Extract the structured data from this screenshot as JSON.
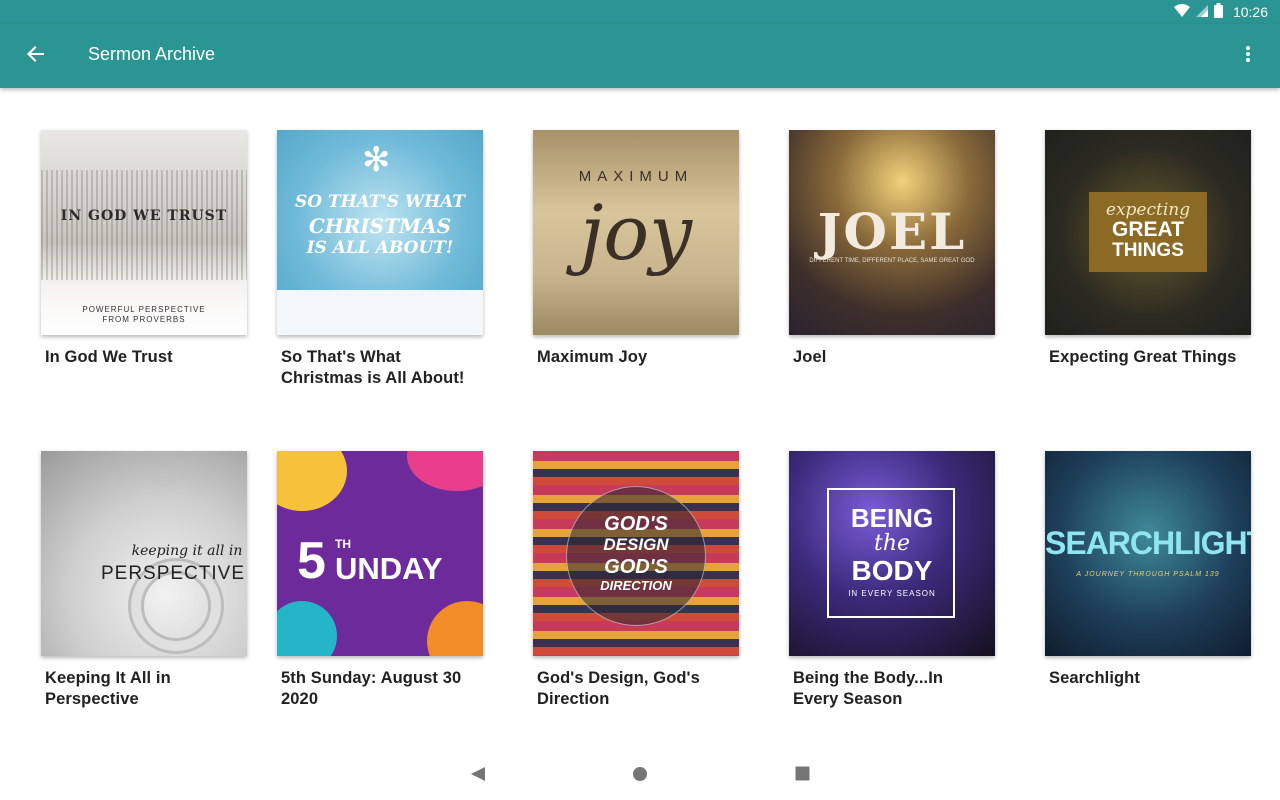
{
  "status": {
    "time": "10:26"
  },
  "app_bar": {
    "title": "Sermon Archive"
  },
  "colors": {
    "accent": "#2a9592"
  },
  "sermons": [
    {
      "title": "In God We Trust",
      "art": {
        "line1": "IN GOD WE TRUST",
        "line2": "POWERFUL PERSPECTIVE",
        "line3": "FROM PROVERBS"
      }
    },
    {
      "title": "So That's What Christmas is All About!",
      "art": {
        "line1": "SO THAT'S WHAT",
        "line2": "CHRISTMAS",
        "line3": "IS ALL ABOUT!"
      }
    },
    {
      "title": "Maximum Joy",
      "art": {
        "line1": "MAXIMUM",
        "line2": "joy"
      }
    },
    {
      "title": "Joel",
      "art": {
        "line1": "JOEL",
        "line2": "DIFFERENT TIME, DIFFERENT PLACE, SAME GREAT GOD"
      }
    },
    {
      "title": "Expecting Great Things",
      "art": {
        "line1": "expecting",
        "line2": "GREAT",
        "line3": "THINGS"
      }
    },
    {
      "title": "Keeping It All in Perspective",
      "art": {
        "line1": "keeping it all in",
        "line2": "PERSPECTIVE"
      }
    },
    {
      "title": "5th Sunday: August 30 2020",
      "art": {
        "line1": "5",
        "line2": "TH",
        "line3": "UNDAY"
      }
    },
    {
      "title": "God's Design, God's Direction",
      "art": {
        "line1": "GOD'S",
        "line2": "DESIGN",
        "line3": "GOD'S",
        "line4": "DIRECTION"
      }
    },
    {
      "title": "Being the Body...In Every Season",
      "art": {
        "line1": "BEING",
        "line2": "the",
        "line3": "BODY",
        "line4": "IN EVERY SEASON"
      }
    },
    {
      "title": "Searchlight",
      "art": {
        "line1": "SEARCHLIGHT",
        "line2": "A JOURNEY THROUGH PSALM 139"
      }
    }
  ]
}
